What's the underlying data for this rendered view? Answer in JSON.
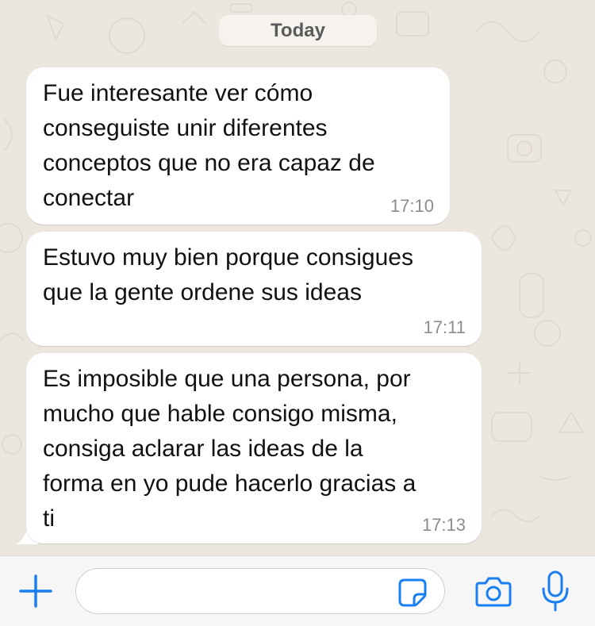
{
  "chat": {
    "date_label": "Today",
    "messages": [
      {
        "text": "Fue interesante ver cómo\nconseguiste unir diferentes\nconceptos que no era capaz de\nconectar",
        "time": "17:10"
      },
      {
        "text": "Estuvo muy bien porque consigues\nque la gente ordene sus ideas",
        "time": "17:11"
      },
      {
        "text": "Es imposible que una persona, por\nmucho que hable consigo misma,\nconsiga aclarar las ideas de la\nforma en yo pude hacerlo gracias a\nti",
        "time": "17:13"
      }
    ]
  },
  "input_bar": {
    "message_value": "",
    "icons": {
      "attach": "plus-icon",
      "sticker": "sticker-icon",
      "camera": "camera-icon",
      "microphone": "microphone-icon"
    }
  },
  "colors": {
    "accent": "#1a7ff0",
    "chat_background": "#ebe6de",
    "bubble": "#ffffff",
    "timestamp": "#8c8c8c"
  }
}
